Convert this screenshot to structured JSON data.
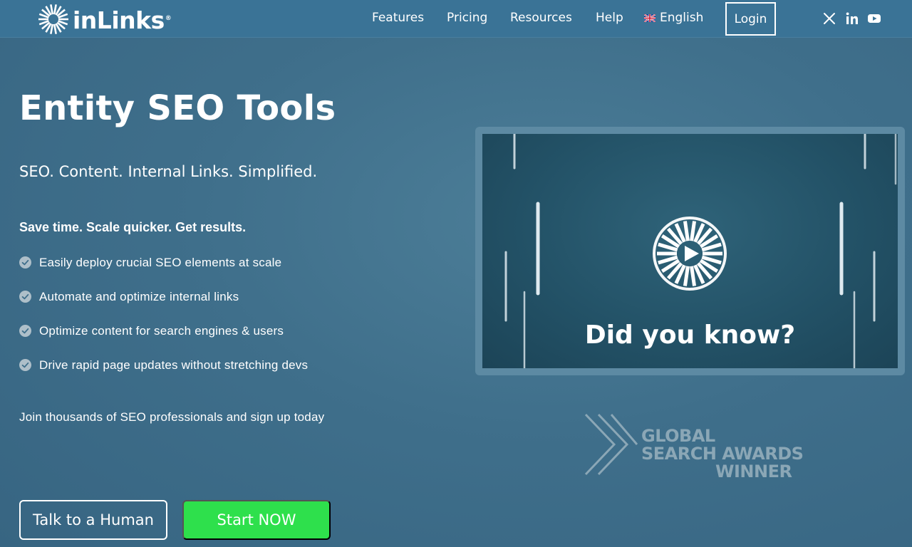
{
  "header": {
    "logo_text": "inLinks",
    "logo_reg": "®",
    "nav": [
      {
        "label": "Features"
      },
      {
        "label": "Pricing"
      },
      {
        "label": "Resources"
      },
      {
        "label": "Help"
      }
    ],
    "language": {
      "label": "English",
      "flag_icon": "uk-flag-icon"
    },
    "login_label": "Login",
    "social_icons": [
      "x-twitter-icon",
      "linkedin-icon",
      "youtube-icon"
    ]
  },
  "hero": {
    "title": "Entity SEO Tools",
    "subtitle": "SEO. Content. Internal Links. Simplified.",
    "benefits_heading": "Save time. Scale quicker. Get results.",
    "features": [
      "Easily deploy crucial SEO elements at scale",
      "Automate and optimize internal links",
      "Optimize content for search engines & users",
      "Drive rapid page updates without stretching devs"
    ],
    "join_text": "Join thousands of SEO professionals and sign up today",
    "buttons": {
      "talk_label": "Talk to a Human",
      "start_label": "Start NOW"
    }
  },
  "video": {
    "caption": "Did you know?",
    "play_icon": "play-icon"
  },
  "award": {
    "line1": "GLOBAL",
    "line2": "SEARCH AWARDS",
    "line3": "WINNER"
  },
  "colors": {
    "background": "#3f6f8b",
    "header": "#3a7396",
    "cta_green": "#2ee04c",
    "award_gray": "#8ba7b6"
  }
}
